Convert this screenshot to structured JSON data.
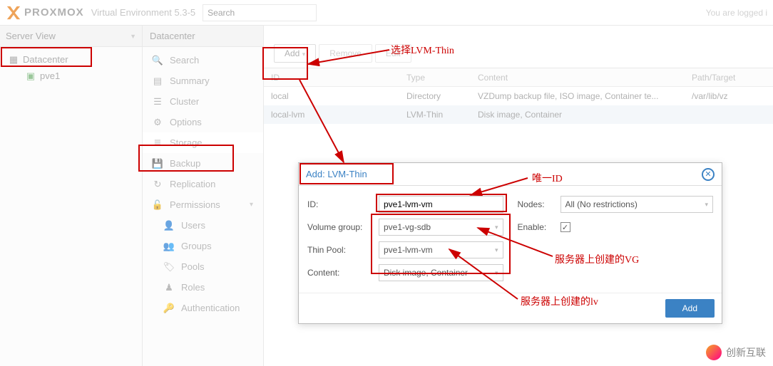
{
  "header": {
    "brand": "PROXMOX",
    "env": "Virtual Environment 5.3-5",
    "search_placeholder": "Search",
    "login_msg": "You are logged i"
  },
  "left": {
    "server_view": "Server View",
    "tree": {
      "root": "Datacenter",
      "child": "pve1"
    }
  },
  "mid": {
    "title": "Datacenter",
    "items": [
      {
        "icon": "search",
        "label": "Search"
      },
      {
        "icon": "book",
        "label": "Summary"
      },
      {
        "icon": "server",
        "label": "Cluster"
      },
      {
        "icon": "gear",
        "label": "Options"
      },
      {
        "icon": "db",
        "label": "Storage"
      },
      {
        "icon": "save",
        "label": "Backup"
      },
      {
        "icon": "refresh",
        "label": "Replication"
      },
      {
        "icon": "unlock",
        "label": "Permissions"
      },
      {
        "icon": "user",
        "label": "Users",
        "sub": true
      },
      {
        "icon": "users",
        "label": "Groups",
        "sub": true
      },
      {
        "icon": "tags",
        "label": "Pools",
        "sub": true
      },
      {
        "icon": "male",
        "label": "Roles",
        "sub": true
      },
      {
        "icon": "key",
        "label": "Authentication",
        "sub": true
      }
    ]
  },
  "toolbar": {
    "add": "Add",
    "remove": "Remove",
    "edit": "Edit"
  },
  "table": {
    "headers": {
      "id": "ID",
      "type": "Type",
      "content": "Content",
      "path": "Path/Target"
    },
    "rows": [
      {
        "id": "local",
        "type": "Directory",
        "content": "VZDump backup file, ISO image, Container te...",
        "path": "/var/lib/vz"
      },
      {
        "id": "local-lvm",
        "type": "LVM-Thin",
        "content": "Disk image, Container",
        "path": ""
      }
    ]
  },
  "dialog": {
    "title": "Add: LVM-Thin",
    "fields": {
      "id_label": "ID:",
      "id_value": "pve1-lvm-vm",
      "vg_label": "Volume group:",
      "vg_value": "pve1-vg-sdb",
      "tp_label": "Thin Pool:",
      "tp_value": "pve1-lvm-vm",
      "content_label": "Content:",
      "content_value": "Disk image, Container",
      "nodes_label": "Nodes:",
      "nodes_value": "All (No restrictions)",
      "enable_label": "Enable:"
    },
    "add_btn": "Add"
  },
  "annotations": {
    "a1": "选择LVM-Thin",
    "a2": "唯一ID",
    "a3": "服务器上创建的VG",
    "a4": "服务器上创建的lv"
  },
  "watermark": "创新互联"
}
